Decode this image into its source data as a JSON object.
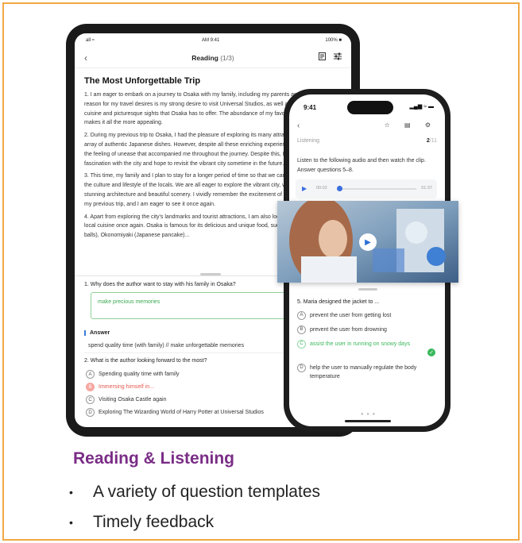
{
  "tablet": {
    "status": {
      "left": "all ≈",
      "time": "AM 9:41",
      "battery": "100% ■"
    },
    "nav": {
      "back": "‹",
      "title": "Reading",
      "page": "(1/3)",
      "icon1": "doc-icon",
      "icon2": "settings-sliders-icon"
    },
    "heading": "The Most Unforgettable Trip",
    "paragraphs": [
      "1. I am eager to embark on a journey to Osaka with my family, including my parents and sisters. The main reason for my travel desires is my strong desire to visit Universal Studios, as well as indulge in the local cuisine and picturesque sights that Osaka has to offer. The abundance of my favorite foods in Osaka makes it all the more appealing.",
      "2. During my previous trip to Osaka, I had the pleasure of exploring its many attractions and relishing in an array of authentic Japanese dishes. However, despite all these enriching experiences, I could not shake the feeling of unease that accompanied me throughout the journey. Despite this, I still hold a strong fascination with the city and hope to revisit the vibrant city sometime in the future.",
      "3. This time, my family and I plan to stay for a longer period of time so that we can immerse ourselves in the culture and lifestyle of the locals. We are all eager to explore the vibrant city, which is known for its stunning architecture and beautiful scenery. I vividly remember the excitement of visiting Osaka Castle on my previous trip, and I am eager to see it once again.",
      "4. Apart from exploring the city's landmarks and tourist attractions, I am also looking forward to trying the local cuisine once again. Osaka is famous for its delicious and unique food, such as Takoyaki (octopus balls), Okonomiyaki (Japanese pancake)..."
    ],
    "q1": "1. Why does the author want to stay with his family in Osaka?",
    "q1_answer_input": "make precious memories",
    "answer_label": "Answer",
    "answer_text": "spend quality time (with family) // make unforgettable memories",
    "q2": "2. What is the author looking forward to the most?",
    "q2_options": [
      {
        "letter": "A",
        "text": "Spending quality time with family"
      },
      {
        "letter": "B",
        "text": "Immersing himself in..."
      },
      {
        "letter": "C",
        "text": "Visiting Osaka Castle again"
      },
      {
        "letter": "D",
        "text": "Exploring The Wizarding World of Harry Potter at Universal Studios"
      }
    ]
  },
  "phone": {
    "time": "9:41",
    "signal": "▂▄▆ ≈ ▬",
    "back": "‹",
    "icons": "☆ ▤ ⚙",
    "section": "Listening",
    "page": "2",
    "page_total": "/11",
    "instruction": "Listen to the following audio and then watch the clip. Answer questions 5–8.",
    "audio": {
      "play": "▶",
      "current": "00:02",
      "total": "01:37",
      "progress": 0.02
    },
    "q5": "5. Maria designed the jacket to ...",
    "options": [
      {
        "letter": "A",
        "text": "prevent the user from getting lost"
      },
      {
        "letter": "B",
        "text": "prevent the user from drowning"
      },
      {
        "letter": "C",
        "text": "assist the user in running on snowy days"
      },
      {
        "letter": "D",
        "text": "help the user to manually regulate the body temperature"
      }
    ],
    "check": "✓",
    "dots": "● ● ●"
  },
  "video": {
    "play": "▶"
  },
  "footer": {
    "title": "Reading & Listening",
    "bullets": [
      "A variety of question templates",
      "Timely feedback"
    ],
    "bullet_char": "•"
  }
}
